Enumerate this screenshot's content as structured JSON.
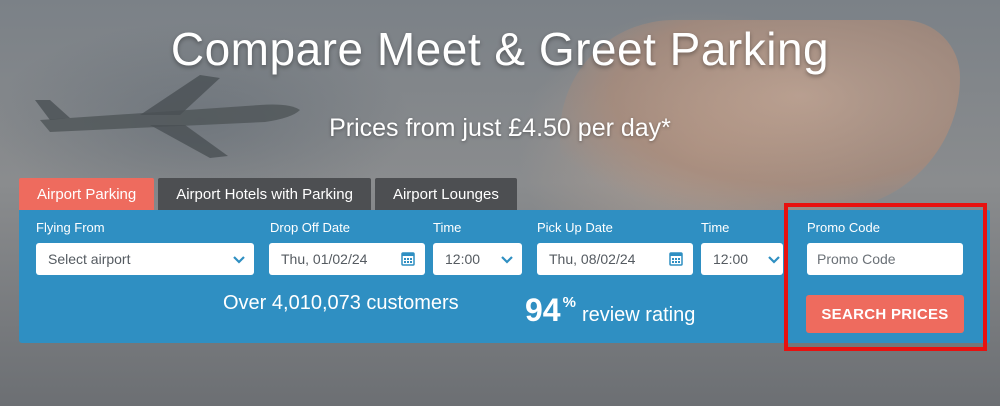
{
  "hero": {
    "title": "Compare Meet & Greet Parking",
    "subtitle": "Prices from just £4.50 per day*"
  },
  "tabs": [
    {
      "label": "Airport Parking",
      "active": true
    },
    {
      "label": "Airport Hotels with Parking",
      "active": false
    },
    {
      "label": "Airport Lounges",
      "active": false
    }
  ],
  "form": {
    "flying_from": {
      "label": "Flying From",
      "value": "Select airport"
    },
    "drop_off_date": {
      "label": "Drop Off Date",
      "value": "Thu, 01/02/24"
    },
    "drop_off_time": {
      "label": "Time",
      "value": "12:00"
    },
    "pick_up_date": {
      "label": "Pick Up Date",
      "value": "Thu, 08/02/24"
    },
    "pick_up_time": {
      "label": "Time",
      "value": "12:00"
    },
    "promo": {
      "label": "Promo Code",
      "placeholder": "Promo Code"
    },
    "search_label": "SEARCH PRICES"
  },
  "stats": {
    "customers_text": "Over 4,010,073 customers",
    "rating_value": "94",
    "rating_unit": "%",
    "rating_text": "review rating"
  },
  "colors": {
    "panel": "#2f8fc2",
    "accent": "#ee6b5e",
    "tab_inactive": "#4d4f52",
    "highlight_border": "#e8110f"
  },
  "icons": {
    "dropdown": "chevron-down-icon",
    "date": "calendar-icon"
  }
}
